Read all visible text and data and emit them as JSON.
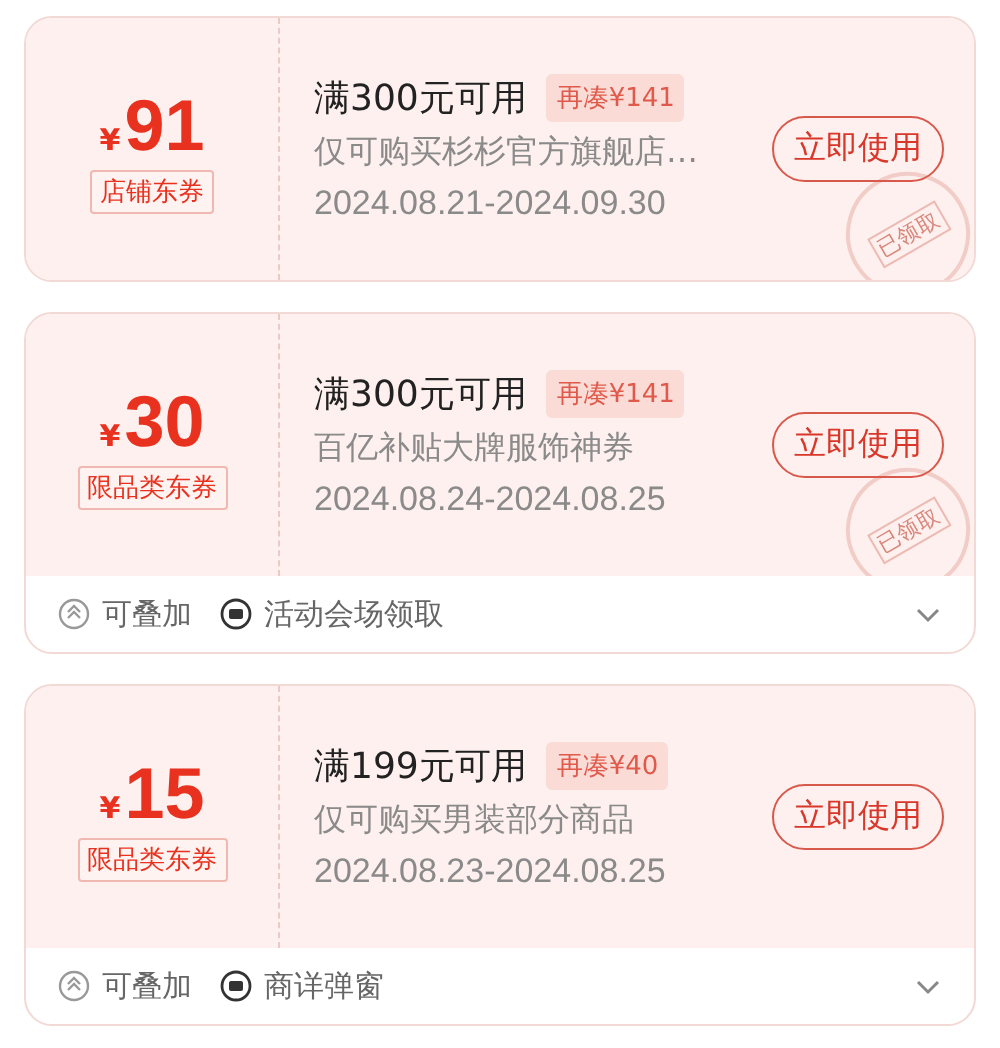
{
  "coupons": [
    {
      "currency": "¥",
      "amount": "91",
      "type_tag": "店铺东券",
      "condition": "满300元可用",
      "shortfall": "再凑¥141",
      "description": "仅可购买杉杉官方旗舰店…",
      "validity": "2024.08.21-2024.09.30",
      "button": "立即使用",
      "stamp": "已领取"
    },
    {
      "currency": "¥",
      "amount": "30",
      "type_tag": "限品类东券",
      "condition": "满300元可用",
      "shortfall": "再凑¥141",
      "description": "百亿补贴大牌服饰神券",
      "validity": "2024.08.24-2024.08.25",
      "button": "立即使用",
      "stamp": "已领取",
      "footer": {
        "items": [
          {
            "kind": "stackable",
            "label": "可叠加"
          },
          {
            "kind": "source",
            "label": "活动会场领取"
          }
        ],
        "expanded": false
      }
    },
    {
      "currency": "¥",
      "amount": "15",
      "type_tag": "限品类东券",
      "condition": "满199元可用",
      "shortfall": "再凑¥40",
      "description": "仅可购买男装部分商品",
      "validity": "2024.08.23-2024.08.25",
      "button": "立即使用",
      "footer": {
        "items": [
          {
            "kind": "stackable",
            "label": "可叠加"
          },
          {
            "kind": "source",
            "label": "商详弹窗"
          }
        ],
        "expanded": false
      }
    }
  ]
}
